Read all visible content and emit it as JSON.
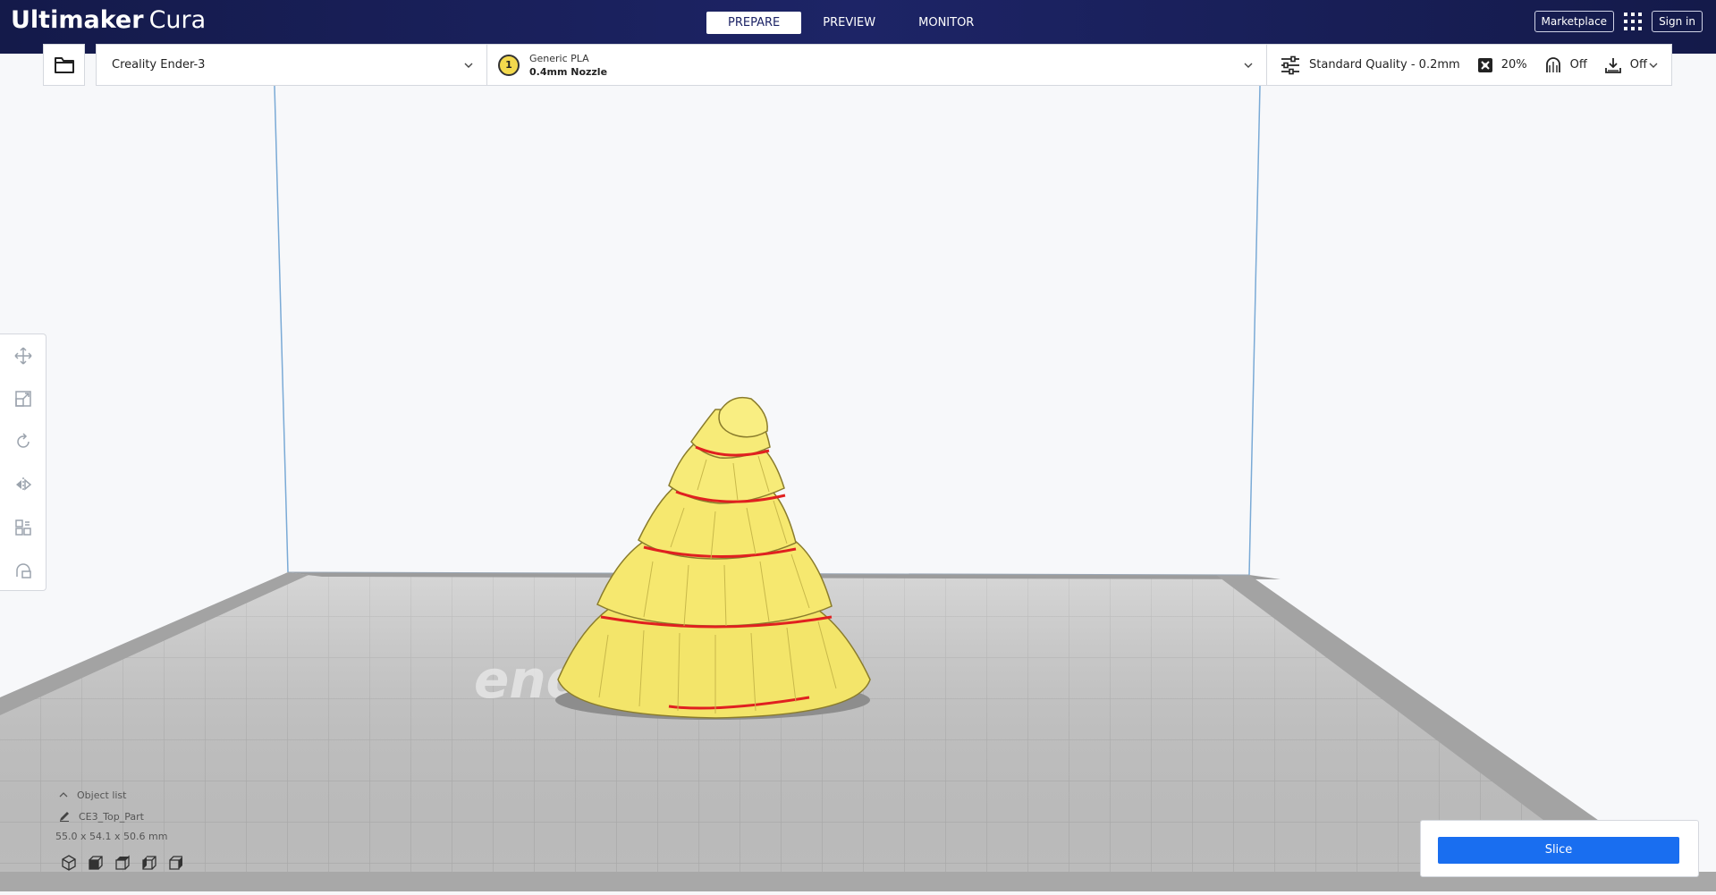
{
  "app": {
    "brand": "Ultimaker",
    "product": "Cura"
  },
  "stages": [
    {
      "label": "PREPARE",
      "active": true
    },
    {
      "label": "PREVIEW",
      "active": false
    },
    {
      "label": "MONITOR",
      "active": false
    }
  ],
  "top_right": {
    "marketplace": "Marketplace",
    "sign_in": "Sign in"
  },
  "printer": {
    "name": "Creality Ender-3"
  },
  "material": {
    "extruder_number": "1",
    "name": "Generic PLA",
    "nozzle": "0.4mm Nozzle"
  },
  "print_settings": {
    "profile": "Standard Quality - 0.2mm",
    "infill": "20%",
    "support": "Off",
    "adhesion": "Off"
  },
  "object_list": {
    "header": "Object list",
    "object_name": "CE3_Top_Part",
    "dimensions": "55.0 x 54.1 x 50.6 mm"
  },
  "slice": {
    "label": "Slice"
  },
  "colors": {
    "header_bg": "#1d2466",
    "accent_blue": "#196ef0",
    "model_yellow": "#f6e86f",
    "overhang_red": "#e02020",
    "plate_grey": "#c9c9c9"
  }
}
